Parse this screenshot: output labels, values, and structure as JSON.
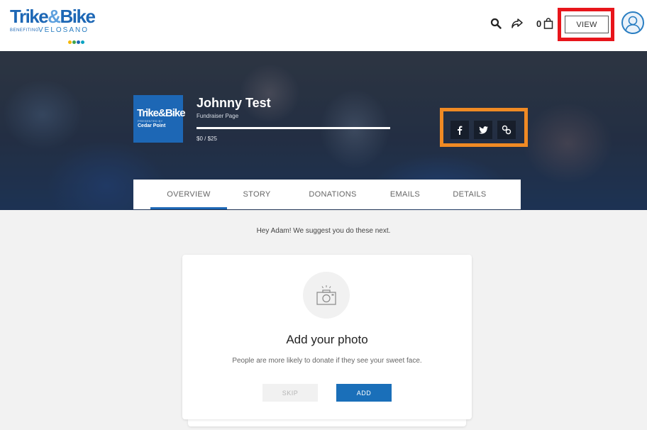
{
  "brand": {
    "logo_main": "Trike",
    "logo_amp": "&",
    "logo_main_end": "Bike",
    "logo_sub": "BENEFITING",
    "logo_velo": "VELOSANO",
    "dot_colors": [
      "#f5b700",
      "#3fa34d",
      "#1d67b5",
      "#0aa3c2"
    ]
  },
  "header": {
    "icons": [
      "search-icon",
      "share-arrow-icon",
      "shopping-bag-icon"
    ],
    "cart_count": "0",
    "view_label": "VIEW"
  },
  "hero": {
    "tile_main": "Trike&Bike",
    "tile_sub": "PRESENTED BY",
    "tile_sponsor": "Cedar Point",
    "name": "Johnny Test",
    "page_type": "Fundraiser Page",
    "amount": "$0 / $25",
    "progress_fraction": 1.0,
    "share_icons": [
      "facebook-icon",
      "twitter-icon",
      "link-icon"
    ]
  },
  "tabs": [
    "OVERVIEW",
    "STORY",
    "DONATIONS",
    "EMAILS",
    "DETAILS"
  ],
  "active_tab": "OVERVIEW",
  "main": {
    "suggestion": "Hey Adam! We suggest you do these next.",
    "card": {
      "title": "Add your photo",
      "description": "People are more likely to donate if they see your sweet face.",
      "skip_label": "SKIP",
      "add_label": "ADD"
    }
  },
  "colors": {
    "brand_blue": "#1d67b5",
    "highlight_red": "#e8151b",
    "highlight_orange": "#f08a24",
    "add_button": "#1a6fb9"
  }
}
